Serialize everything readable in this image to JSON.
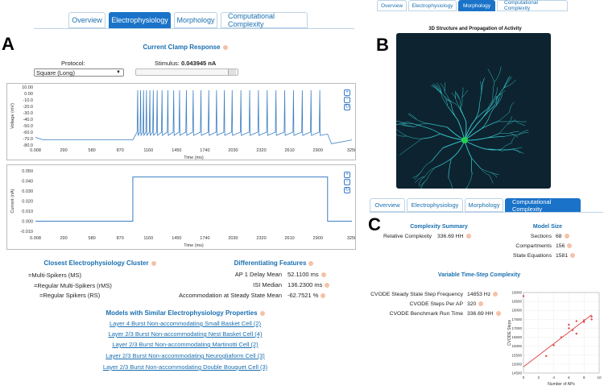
{
  "panel_a": {
    "letter": "A",
    "tabs": [
      {
        "label": "Overview",
        "active": false
      },
      {
        "label": "Electrophysiology",
        "active": true
      },
      {
        "label": "Morphology",
        "active": false
      },
      {
        "label": "Computational Complexity",
        "active": false
      }
    ],
    "title": "Current Clamp Response",
    "protocol_label": "Protocol:",
    "protocol_value": "Square (Long)",
    "stimulus_label": "Stimulus:",
    "stimulus_value": "0.043945 nA",
    "stimulus_slider_fraction": 0.98,
    "voltage_plot": {
      "ylabel": "Voltage (mV)",
      "xlabel": "Time (ms)",
      "yticks": [
        "10.00",
        "0.00",
        "-10.0",
        "-20.0",
        "-30.0",
        "-40.0",
        "-50.0",
        "-60.0",
        "-70.0",
        "-80.0"
      ],
      "xticks": [
        "0.008",
        "290",
        "580",
        "870",
        "1160",
        "1450",
        "1740",
        "2030",
        "2320",
        "2610",
        "2900",
        "3250"
      ]
    },
    "current_plot": {
      "ylabel": "Current (nA)",
      "xlabel": "Time (ms)",
      "yticks": [
        "0.050",
        "0.040",
        "0.030",
        "0.020",
        "0.010",
        "0.000",
        "-0.010"
      ],
      "xticks": [
        "0.008",
        "290",
        "580",
        "870",
        "1160",
        "1450",
        "1740",
        "2030",
        "2320",
        "2610",
        "2900",
        "3250"
      ]
    },
    "cluster_title": "Closest Electrophysiology Cluster",
    "clusters": [
      "=Multi-Spikers (MS)",
      "=Regular Multi-Spikers (rMS)",
      "=Regular Spikers (RS)"
    ],
    "features_title": "Differentiating Features",
    "features": [
      {
        "label": "AP 1 Delay Mean",
        "value": "52.1100 ms"
      },
      {
        "label": "ISI Median",
        "value": "136.2300 ms"
      },
      {
        "label": "Accommodation at Steady State Mean",
        "value": "-62.7521 %"
      }
    ],
    "models_title": "Models with Similar Electrophysiology Properties",
    "models": [
      "Layer 4 Burst Non-accommodating Small Basket Cell (2)",
      "Layer 2/3 Burst Non-accommodating Nest Basket Cell (4)",
      "Layer 2/3 Burst Non-accommodating Martinotti Cell (2)",
      "Layer 2/3 Burst Non-accommodating Neurogliaform Cell (3)",
      "Layer 2/3 Burst Non-accommodating Double Bouquet Cell (3)"
    ]
  },
  "panel_b": {
    "letter": "B",
    "tabs": [
      {
        "label": "Overview",
        "active": false
      },
      {
        "label": "Electrophysiology",
        "active": false
      },
      {
        "label": "Morphology",
        "active": true
      },
      {
        "label": "Computational Complexity",
        "active": false
      }
    ],
    "title": "3D Structure and Propagation of Activity",
    "bg_color": "#0d2430",
    "neuron_color": "#35c0c6",
    "soma_color": "#22d04a"
  },
  "panel_c": {
    "letter": "C",
    "tabs": [
      {
        "label": "Overview",
        "active": false
      },
      {
        "label": "Electrophysiology",
        "active": false
      },
      {
        "label": "Morphology",
        "active": false
      },
      {
        "label": "Computational Complexity",
        "active": true
      }
    ],
    "complexity_title": "Complexity Summary",
    "relative_label": "Relative Complexity",
    "relative_value": "336.69 HH",
    "model_size_title": "Model Size",
    "model_size": [
      {
        "label": "Sections",
        "value": "68"
      },
      {
        "label": "Compartments",
        "value": "156"
      },
      {
        "label": "State Equations",
        "value": "1581"
      }
    ],
    "variable_title": "Variable Time-Step Complexity",
    "variable_rows": [
      {
        "label": "CVODE Steady State Step Frequency",
        "value": "14853 Hz"
      },
      {
        "label": "CVODE Steps Per AP",
        "value": "320"
      },
      {
        "label": "CVODE Benchmark Run Time",
        "value": "336.69 HH"
      }
    ]
  },
  "chart_data": [
    {
      "type": "line",
      "ylabel": "Voltage (mV)",
      "xlabel": "Time (ms)",
      "xlim": [
        0.008,
        3250
      ],
      "ylim": [
        -80,
        10
      ],
      "resting_potential": -72,
      "stimulus_on": 1000,
      "stimulus_off": 3000,
      "spike_peak": 5,
      "spike_trough": -60,
      "spike_times": [
        1050,
        1080,
        1110,
        1140,
        1175,
        1210,
        1250,
        1300,
        1360,
        1420,
        1480,
        1550,
        1620,
        1700,
        1780,
        1860,
        1940,
        2020,
        2110,
        2200,
        2290,
        2380,
        2470,
        2560,
        2650,
        2740,
        2830,
        2920
      ]
    },
    {
      "type": "line",
      "ylabel": "Current (nA)",
      "xlabel": "Time (ms)",
      "xlim": [
        0.008,
        3250
      ],
      "ylim": [
        -0.01,
        0.05
      ],
      "x": [
        0,
        1000,
        1000,
        3000,
        3000,
        3250
      ],
      "y": [
        0,
        0,
        0.0439,
        0.0439,
        0,
        0
      ]
    },
    {
      "type": "scatter",
      "xlabel": "Number of APs",
      "ylabel": "CVODE Steps",
      "xlim": [
        0,
        10
      ],
      "ylim": [
        14500,
        19000
      ],
      "xticks": [
        0,
        2,
        4,
        6,
        8,
        10
      ],
      "yticks": [
        14500,
        15000,
        15500,
        16000,
        16500,
        17000,
        17500,
        18000,
        18500,
        19000
      ],
      "points": [
        [
          0,
          18800
        ],
        [
          3,
          15450
        ],
        [
          4,
          16050
        ],
        [
          5,
          16500
        ],
        [
          6,
          17200
        ],
        [
          6,
          17000
        ],
        [
          6.5,
          16900
        ],
        [
          7,
          17400
        ],
        [
          7,
          16700
        ],
        [
          8,
          17350
        ],
        [
          8,
          17450
        ],
        [
          9,
          17500
        ],
        [
          9,
          17650
        ]
      ],
      "fit": {
        "x": [
          0,
          9
        ],
        "y": [
          14850,
          17750
        ]
      }
    }
  ]
}
